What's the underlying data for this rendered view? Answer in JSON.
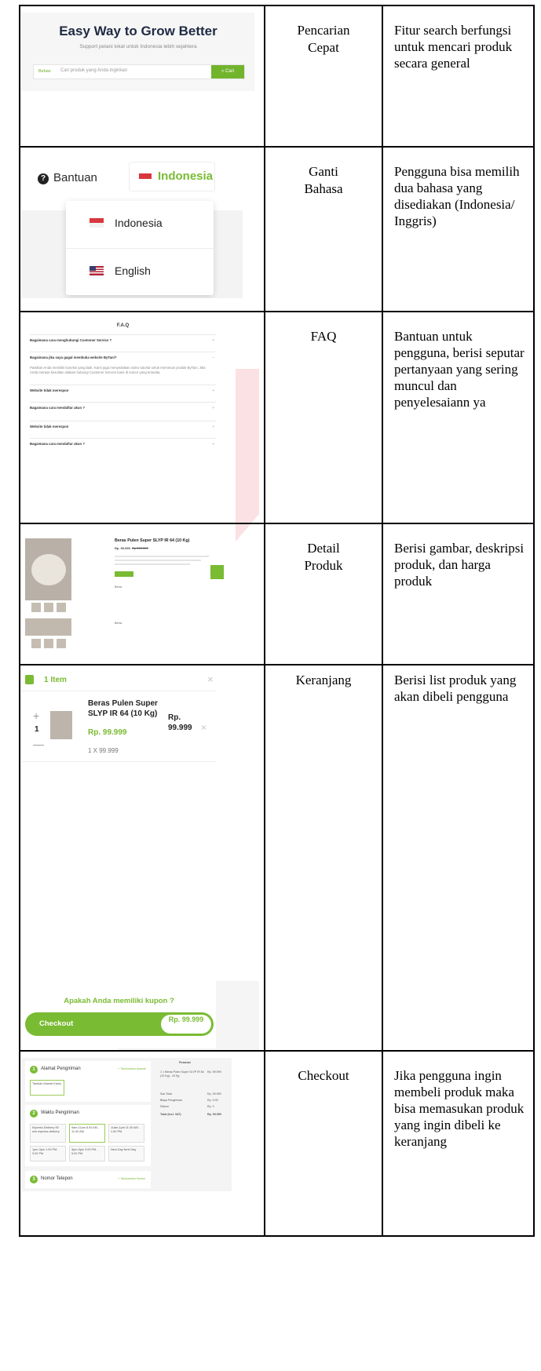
{
  "rows": [
    {
      "feature": "Pencarian\nCepat",
      "description": "Fitur search berfungsi untuk mencari produk secara general",
      "search": {
        "heading": "Easy Way to Grow Better",
        "subheading": "Support petani lokal untuk Indonesia lebih sejahtera",
        "category": "Bebas",
        "placeholder": "Cari produk yang Anda inginkan",
        "button": "Cari"
      }
    },
    {
      "feature": "Ganti\nBahasa",
      "description": "Pengguna bisa memilih dua bahasa yang disediakan (Indonesia/ Inggris)",
      "language": {
        "help": "Bantuan",
        "selected": "Indonesia",
        "options": [
          "Indonesia",
          "English"
        ]
      }
    },
    {
      "feature": "FAQ",
      "description": "Bantuan untuk pengguna, berisi seputar pertanyaan yang sering muncul dan penyelesaiann ya",
      "faq": {
        "title": "F.A.Q",
        "questions": [
          "Bagaimana cara menghubungi Customer Service ?",
          "Bagaimana jika saya gagal membuka website ByTani?",
          "Website tidak merespon",
          "Bagaimana cara mendaftar akun ?",
          "Website tidak merespon",
          "Bagaimana cara mendaftar akun ?"
        ],
        "answer": "Pastikan Anda memiliki koneksi yang baik. Kami juga menyediakan video tutorial untuk memesan produk ByTani. Jika Anda merasa kesulitan silakan hubungi Customer Service kami di nomor yang tersedia."
      }
    },
    {
      "feature": "Detail\nProduk",
      "description": "Berisi gambar, deskripsi produk, dan harga produk",
      "product": {
        "title": "Beras Pulen Super SLYP IR 64 (10 Kg)",
        "price": "Rp. 99.999",
        "old_price": "Rp 109.999",
        "label_a": "Beras",
        "label_b": "Beras"
      }
    },
    {
      "feature": "Keranjang",
      "description": "Berisi list produk yang akan dibeli pengguna",
      "cart": {
        "count": "1 Item",
        "quantity": "1",
        "name": "Beras Pulen Super SLYP IR 64 (10 Kg)",
        "price": "Rp. 99.999",
        "unit": "1 X 99.999",
        "total": "Rp. 99.999",
        "coupon": "Apakah Anda memiliki kupon ?",
        "checkout": "Checkout",
        "checkout_amount": "Rp. 99.999"
      }
    },
    {
      "feature": "Checkout",
      "description": "Jika pengguna ingin membeli produk maka bisa memasukan produk yang ingin dibeli ke keranjang",
      "checkout": {
        "address_title": "Alamat Pengiriman",
        "address_link": "+ Tambahkan Alamat",
        "address_box": "Tambah Alamat Kamu",
        "time_title": "Waktu Pengiriman",
        "slots": [
          "Express Delivery 90 min express delivery",
          "9am-11am 8.00 AM - 11.00 AM",
          "11am-1pm 11.00 AM - 1.00 PM",
          "1pm-3pm 1.00 PM - 3.00 PM",
          "3pm-5pm 3.00 PM - 5.00 PM",
          "Next Day Next Day"
        ],
        "phone_title": "Nomor Telepon",
        "phone_link": "+ Tambahkan Nomor",
        "summary_title": "Pesanan",
        "summary_item": "1 × Beras Pulen Super SLYP IR 64 (10 Kg) - 10 Kg",
        "summary_item_price": "Rp. 99.999",
        "summary_rows": [
          [
            "Sub Total",
            "Rp. 99.999"
          ],
          [
            "Biaya Pengiriman",
            "Rp. 0.00"
          ],
          [
            "Diskon",
            "Rp. 0"
          ],
          [
            "Total (Incl. VAT)",
            "Rp. 99.999"
          ]
        ]
      }
    }
  ]
}
